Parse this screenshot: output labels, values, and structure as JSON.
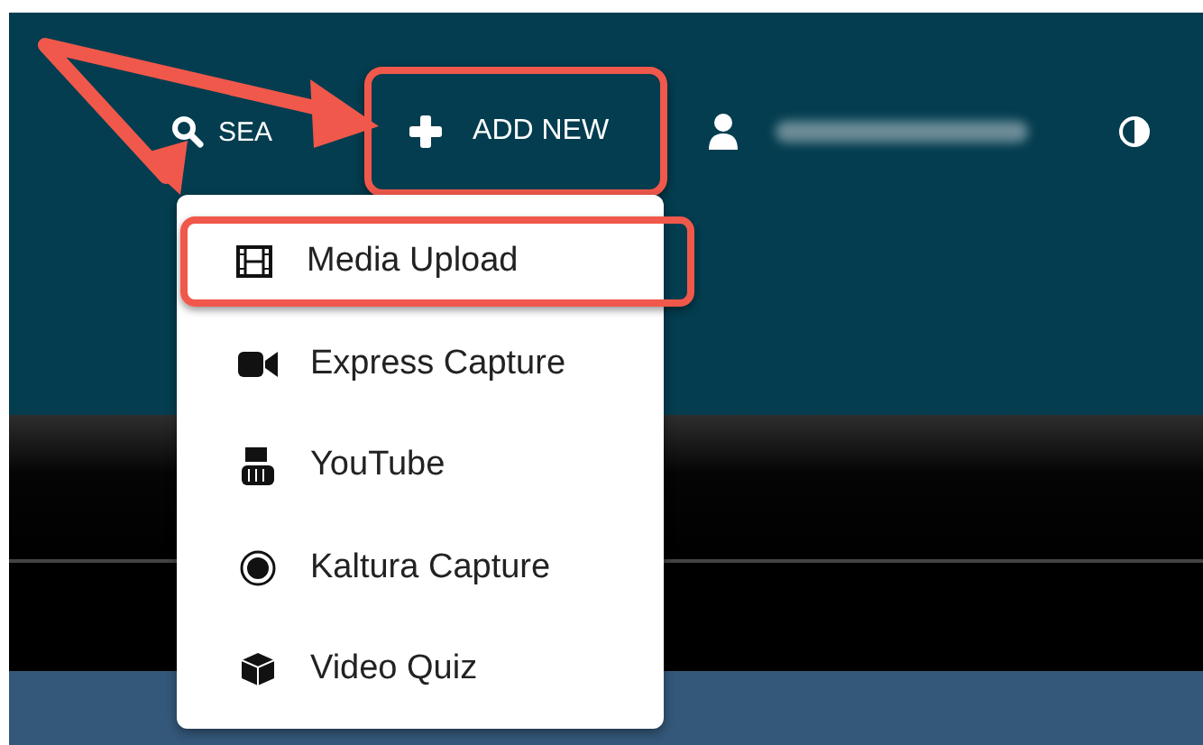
{
  "nav": {
    "search": "SEA",
    "add_new": {
      "label": "ADD NEW",
      "highlighted": true
    }
  },
  "menu": [
    {
      "label": "Media Upload",
      "kind": "film",
      "highlighted": true
    },
    {
      "label": "Express Capture",
      "kind": "camera",
      "highlighted": false
    },
    {
      "label": "YouTube",
      "kind": "youtube",
      "highlighted": false
    },
    {
      "label": "Kaltura Capture",
      "kind": "record",
      "highlighted": false
    },
    {
      "label": "Video Quiz",
      "kind": "cube",
      "highlighted": false
    }
  ]
}
